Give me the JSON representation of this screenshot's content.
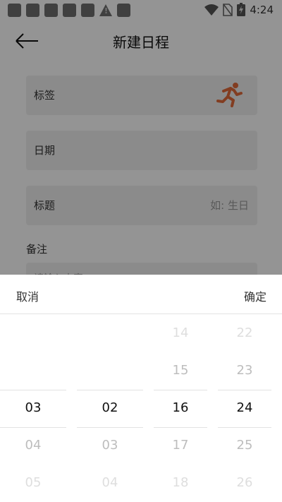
{
  "status_bar": {
    "time": "4:24"
  },
  "header": {
    "title": "新建日程"
  },
  "form": {
    "tag_label": "标签",
    "date_label": "日期",
    "title_label": "标题",
    "title_placeholder": "如: 生日",
    "notes_label": "备注",
    "notes_placeholder": "请输入内容"
  },
  "picker": {
    "cancel_label": "取消",
    "confirm_label": "确定",
    "columns": [
      {
        "items": [
          "03",
          "04",
          "05"
        ],
        "selected": "03"
      },
      {
        "items": [
          "02",
          "03",
          "04"
        ],
        "selected": "02"
      },
      {
        "items": [
          "14",
          "15",
          "16",
          "17",
          "18"
        ],
        "selected": "16"
      },
      {
        "items": [
          "22",
          "23",
          "24",
          "25",
          "26"
        ],
        "selected": "24"
      }
    ]
  },
  "colors": {
    "tag_icon": "#e06a3a",
    "dim_overlay": "#000000"
  }
}
